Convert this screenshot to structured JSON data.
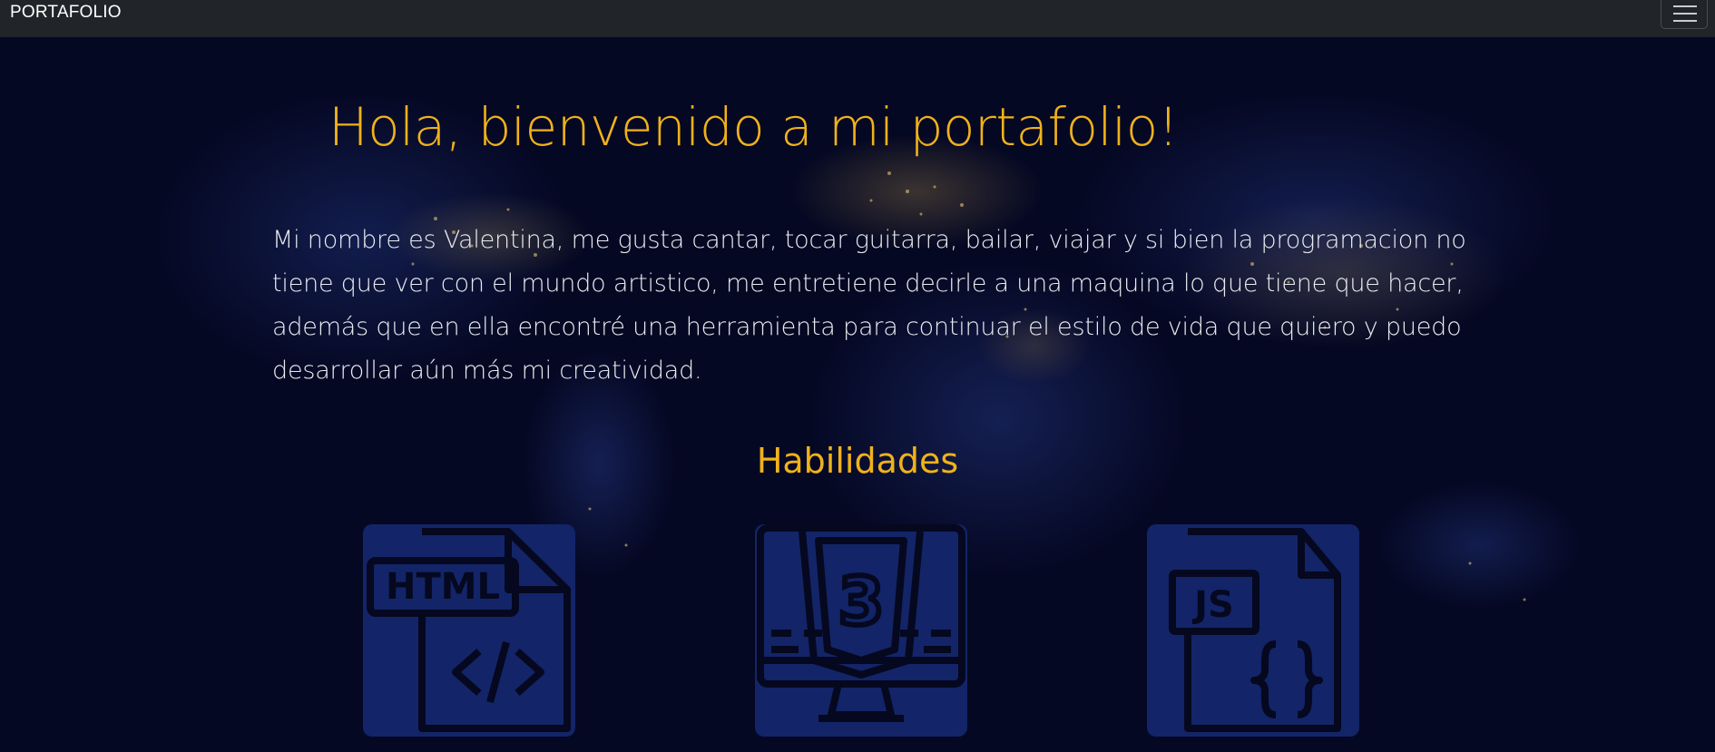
{
  "navbar": {
    "brand": "PORTAFOLIO",
    "toggler_icon": "hamburger-menu-icon"
  },
  "hero": {
    "title": "Hola, bienvenido a mi portafolio!",
    "intro": "Mi nombre es Valentina, me gusta cantar, tocar guitarra, bailar, viajar y si bien la programacion no tiene que ver con el mundo artistico, me entretiene decirle a una maquina lo que tiene que hacer, además que en ella encontré una herramienta para continuar el estilo de vida que quiero y puedo desarrollar aún más mi creatividad."
  },
  "skills": {
    "title": "Habilidades",
    "items": [
      {
        "icon": "html-file-icon",
        "label": "HTML"
      },
      {
        "icon": "css3-monitor-icon",
        "label": "3"
      },
      {
        "icon": "js-file-icon",
        "label": "JS"
      }
    ]
  },
  "colors": {
    "accent": "#f0b21b",
    "navbar_bg": "#212529",
    "card_bg": "#132568",
    "background": "#050823"
  }
}
